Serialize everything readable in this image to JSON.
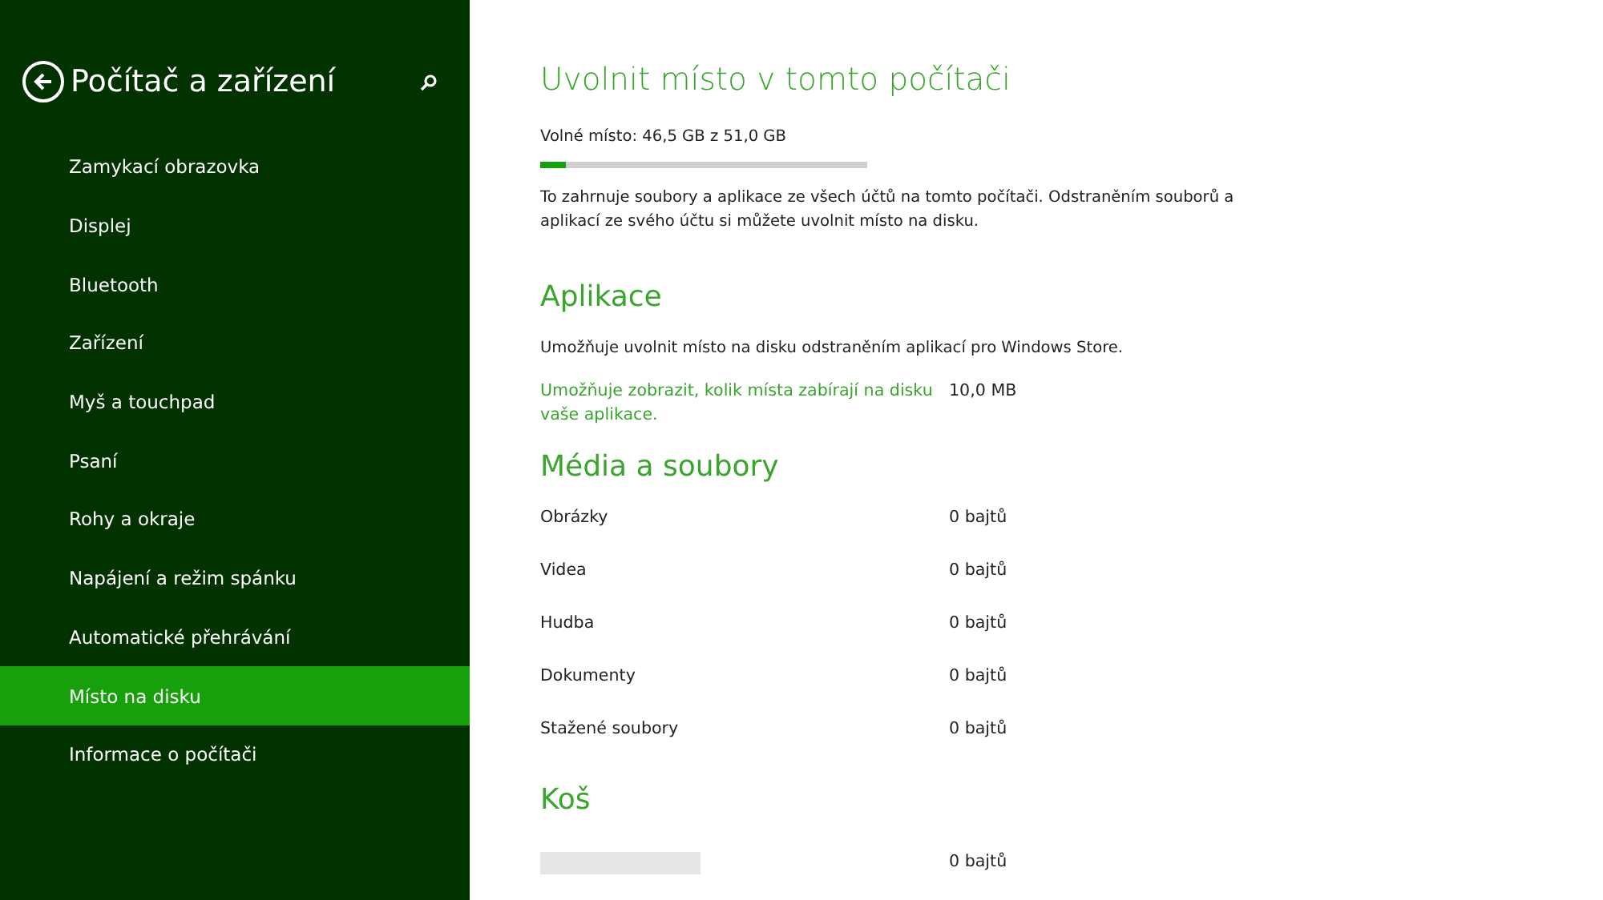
{
  "sidebar": {
    "back_label": "Počítač a zařízení",
    "items": [
      {
        "label": "Zamykací obrazovka",
        "selected": false
      },
      {
        "label": "Displej",
        "selected": false
      },
      {
        "label": "Bluetooth",
        "selected": false
      },
      {
        "label": "Zařízení",
        "selected": false
      },
      {
        "label": "Myš a touchpad",
        "selected": false
      },
      {
        "label": "Psaní",
        "selected": false
      },
      {
        "label": "Rohy a okraje",
        "selected": false
      },
      {
        "label": "Napájení a režim spánku",
        "selected": false
      },
      {
        "label": "Automatické přehrávání",
        "selected": false
      },
      {
        "label": "Místo na disku",
        "selected": true
      },
      {
        "label": "Informace o počítači",
        "selected": false
      }
    ]
  },
  "main": {
    "title": "Uvolnit místo v tomto počítači",
    "free_space": {
      "label": "Volné místo: 46,5 GB z 51,0 GB",
      "level": 0.08
    },
    "description": "To zahrnuje soubory a aplikace ze všech účtů na tomto počítači. Odstraněním souborů a aplikací ze svého účtu si můžete uvolnit místo na disku.",
    "apps": {
      "heading": "Aplikace",
      "description": "Umožňuje uvolnit místo na disku odstraněním aplikací pro Windows Store.",
      "link": "Umožňuje zobrazit, kolik místa zabírají na disku vaše aplikace.",
      "size": "10,0 MB"
    },
    "media": {
      "heading": "Média a soubory",
      "rows": [
        {
          "label": "Obrázky",
          "size": "0 bajtů"
        },
        {
          "label": "Videa",
          "size": "0 bajtů"
        },
        {
          "label": "Hudba",
          "size": "0 bajtů"
        },
        {
          "label": "Dokumenty",
          "size": "0 bajtů"
        },
        {
          "label": "Stažené soubory",
          "size": "0 bajtů"
        }
      ]
    },
    "recycle": {
      "heading": "Koš",
      "size": "0 bajtů"
    }
  }
}
